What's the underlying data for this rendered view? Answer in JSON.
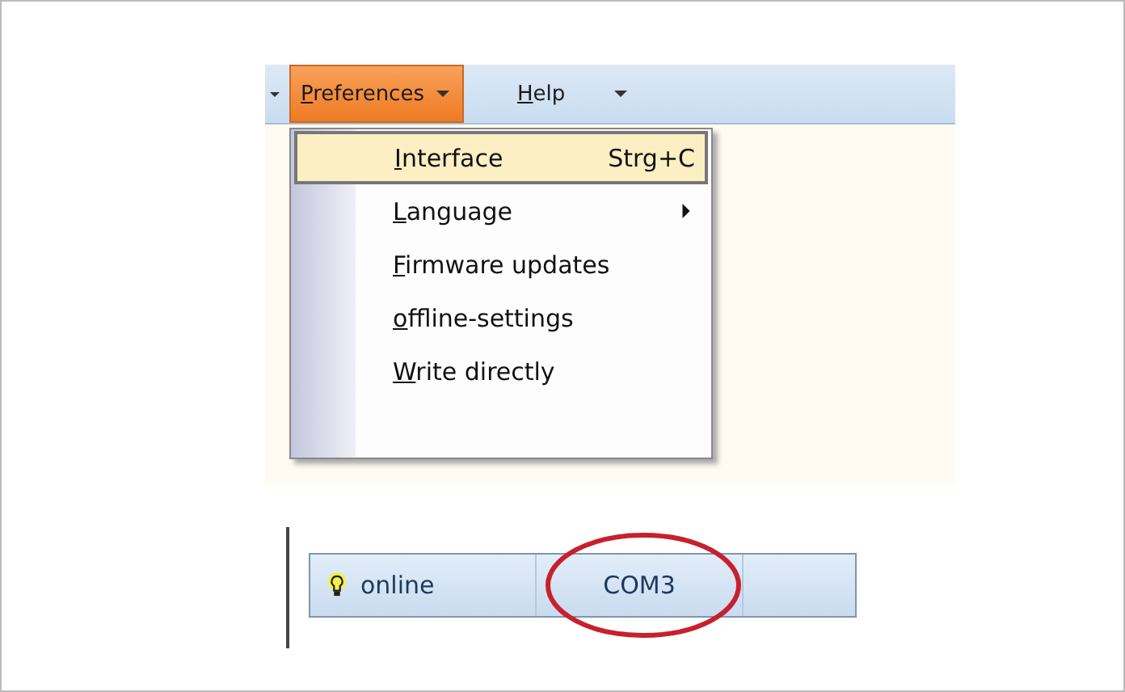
{
  "menubar": [
    {
      "label": [
        {
          "text": "P",
          "underlined": true
        },
        {
          "text": "references",
          "underlined": false
        }
      ],
      "selected": true
    },
    {
      "label": [
        {
          "text": "H",
          "underlined": true
        },
        {
          "text": "elp",
          "underlined": false
        }
      ],
      "selected": false
    }
  ],
  "menu": [
    {
      "label": [
        {
          "text": "I",
          "underlined": true
        },
        {
          "text": "nterface",
          "underlined": false
        }
      ],
      "shortcut": "Strg+C",
      "submenu": false,
      "selected": true
    },
    {
      "label": [
        {
          "text": "L",
          "underlined": true
        },
        {
          "text": "anguage",
          "underlined": false
        }
      ],
      "submenu": true,
      "selected": false
    },
    {
      "label": [
        {
          "text": "F",
          "underlined": true
        },
        {
          "text": "irmware updates",
          "underlined": false
        }
      ],
      "submenu": false,
      "selected": false
    },
    {
      "label": [
        {
          "text": "o",
          "underlined": true
        },
        {
          "text": "ffline-settings",
          "underlined": false
        }
      ],
      "submenu": false,
      "selected": false
    },
    {
      "label": [
        {
          "text": "W",
          "underlined": true
        },
        {
          "text": "rite directly",
          "underlined": false
        }
      ],
      "submenu": false,
      "selected": false
    }
  ],
  "status_bar": {
    "connection": "online",
    "port": "COM3",
    "port_circled": true
  }
}
